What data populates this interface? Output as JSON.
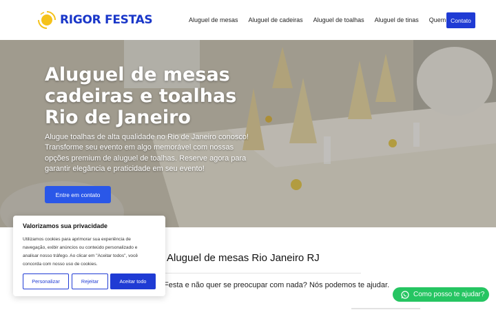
{
  "brand": {
    "name": "RIGOR FESTAS",
    "colors": {
      "primary": "#1f3bd4",
      "sun": "#f5c21b",
      "whatsapp": "#26c562"
    }
  },
  "nav": {
    "items": [
      "Aluguel de mesas",
      "Aluguel de cadeiras",
      "Aluguel de toalhas",
      "Aluguel de tinas",
      "Quem somos"
    ],
    "cta": "Contato"
  },
  "hero": {
    "title_lines": [
      "Aluguel de mesas",
      "cadeiras e toalhas",
      "Rio de Janeiro"
    ],
    "text_lines": [
      "Alugue toalhas de alta qualidade no Rio de Janeiro conosco!",
      "Transforme seu evento em algo memorável com nossas",
      "opções premium de aluguel de toalhas. Reserve agora para",
      "garantir elegância e praticidade em seu evento!"
    ],
    "button": "Entre em contato"
  },
  "section": {
    "title": "Aluguel de mesas Rio Janeiro RJ",
    "text": "Festa e não quer se preocupar com nada? Nós podemos te ajudar."
  },
  "cookie": {
    "title": "Valorizamos sua privacidade",
    "text_lines": [
      "Utilizamos cookies para aprimorar sua experiência de",
      "navegação, exibir anúncios ou conteúdo personalizado e",
      "analisar nosso tráfego. Ao clicar em \"Aceitar todos\", você",
      "concorda com nosso uso de cookies."
    ],
    "buttons": {
      "customize": "Personalizar",
      "reject": "Rejeitar",
      "accept": "Aceitar todo"
    }
  },
  "whatsapp": {
    "label": "Como posso te ajudar?",
    "icon": "whatsapp-icon"
  }
}
